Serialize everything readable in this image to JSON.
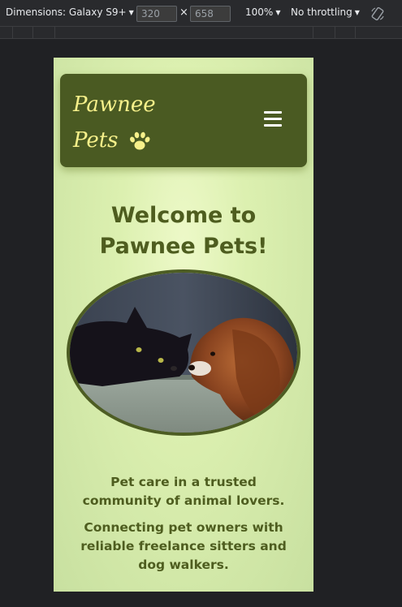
{
  "devtools": {
    "device_label": "Dimensions: Galaxy S9+",
    "width_value": "320",
    "height_value": "658",
    "times_symbol": "×",
    "zoom_label": "100%",
    "throttle_label": "No throttling"
  },
  "site": {
    "logo_line1": "Pawnee",
    "logo_line2": "Pets",
    "heading_line1": "Welcome to",
    "heading_line2": "Pawnee Pets!",
    "tagline1_line1": "Pet care in a trusted",
    "tagline1_line2": "community of animal lovers.",
    "tagline2_line1": "Connecting pet owners with",
    "tagline2_line2": "reliable freelance sitters and",
    "tagline2_line3": "dog walkers."
  },
  "colors": {
    "nav_bg": "#4a5a22",
    "logo_yellow": "#f6f08a",
    "heading_green": "#4e5d1f",
    "page_bg_center": "#edf9c8",
    "page_bg_edge": "#c8e0a0"
  },
  "icons": {
    "logo": "paw-icon",
    "menu": "hamburger-icon",
    "device_rotate": "rotate-icon"
  }
}
